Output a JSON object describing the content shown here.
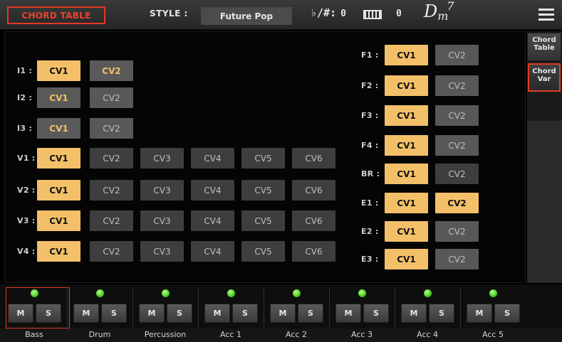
{
  "header": {
    "page_title": "CHORD TABLE",
    "style_label": "STYLE :",
    "style_value": "Future Pop",
    "transpose_symbol": "♭/#:",
    "transpose_value": "0",
    "octave_value": "0",
    "chord_root": "D",
    "chord_sub": "m",
    "chord_sup": "7"
  },
  "side_tabs": {
    "chord_table": "Chord Table",
    "chord_var": "Chord Var"
  },
  "rows_left": [
    {
      "label": "I1 :",
      "cells": [
        {
          "text": "CV1",
          "state": "active"
        },
        {
          "text": "CV2",
          "state": "gold-dim"
        }
      ]
    },
    {
      "label": "I2 :",
      "cells": [
        {
          "text": "CV1",
          "state": "gold-dim"
        },
        {
          "text": "CV2",
          "state": "inactive"
        }
      ]
    },
    {
      "label": "I3 :",
      "cells": [
        {
          "text": "CV1",
          "state": "gold-dim"
        },
        {
          "text": "CV2",
          "state": "inactive"
        }
      ]
    },
    {
      "label": "V1 :",
      "cells": [
        {
          "text": "CV1",
          "state": "active"
        },
        {
          "text": "CV2",
          "state": "dark"
        },
        {
          "text": "CV3",
          "state": "dark"
        },
        {
          "text": "CV4",
          "state": "dark"
        },
        {
          "text": "CV5",
          "state": "dark"
        },
        {
          "text": "CV6",
          "state": "dark"
        }
      ]
    },
    {
      "label": "V2 :",
      "cells": [
        {
          "text": "CV1",
          "state": "active"
        },
        {
          "text": "CV2",
          "state": "dark"
        },
        {
          "text": "CV3",
          "state": "dark"
        },
        {
          "text": "CV4",
          "state": "dark"
        },
        {
          "text": "CV5",
          "state": "dark"
        },
        {
          "text": "CV6",
          "state": "dark"
        }
      ]
    },
    {
      "label": "V3 :",
      "cells": [
        {
          "text": "CV1",
          "state": "active"
        },
        {
          "text": "CV2",
          "state": "dark"
        },
        {
          "text": "CV3",
          "state": "dark"
        },
        {
          "text": "CV4",
          "state": "dark"
        },
        {
          "text": "CV5",
          "state": "dark"
        },
        {
          "text": "CV6",
          "state": "dark"
        }
      ]
    },
    {
      "label": "V4 :",
      "cells": [
        {
          "text": "CV1",
          "state": "active"
        },
        {
          "text": "CV2",
          "state": "dark"
        },
        {
          "text": "CV3",
          "state": "dark"
        },
        {
          "text": "CV4",
          "state": "dark"
        },
        {
          "text": "CV5",
          "state": "dark"
        },
        {
          "text": "CV6",
          "state": "dark"
        }
      ]
    }
  ],
  "rows_right": [
    {
      "label": "F1 :",
      "cells": [
        {
          "text": "CV1",
          "state": "active"
        },
        {
          "text": "CV2",
          "state": "inactive"
        }
      ]
    },
    {
      "label": "F2 :",
      "cells": [
        {
          "text": "CV1",
          "state": "active"
        },
        {
          "text": "CV2",
          "state": "inactive"
        }
      ]
    },
    {
      "label": "F3 :",
      "cells": [
        {
          "text": "CV1",
          "state": "active"
        },
        {
          "text": "CV2",
          "state": "inactive"
        }
      ]
    },
    {
      "label": "F4 :",
      "cells": [
        {
          "text": "CV1",
          "state": "active"
        },
        {
          "text": "CV2",
          "state": "inactive"
        }
      ]
    },
    {
      "label": "BR :",
      "cells": [
        {
          "text": "CV1",
          "state": "active"
        },
        {
          "text": "CV2",
          "state": "dark"
        }
      ]
    },
    {
      "label": "E1 :",
      "cells": [
        {
          "text": "CV1",
          "state": "active"
        },
        {
          "text": "CV2",
          "state": "active"
        }
      ]
    },
    {
      "label": "E2 :",
      "cells": [
        {
          "text": "CV1",
          "state": "active"
        },
        {
          "text": "CV2",
          "state": "inactive"
        }
      ]
    },
    {
      "label": "E3 :",
      "cells": [
        {
          "text": "CV1",
          "state": "active"
        },
        {
          "text": "CV2",
          "state": "inactive"
        }
      ]
    }
  ],
  "tracks": [
    {
      "name": "Bass",
      "mute_label": "M",
      "solo_label": "S"
    },
    {
      "name": "Drum",
      "mute_label": "M",
      "solo_label": "S"
    },
    {
      "name": "Percussion",
      "mute_label": "M",
      "solo_label": "S"
    },
    {
      "name": "Acc 1",
      "mute_label": "M",
      "solo_label": "S"
    },
    {
      "name": "Acc 2",
      "mute_label": "M",
      "solo_label": "S"
    },
    {
      "name": "Acc 3",
      "mute_label": "M",
      "solo_label": "S"
    },
    {
      "name": "Acc 4",
      "mute_label": "M",
      "solo_label": "S"
    },
    {
      "name": "Acc 5",
      "mute_label": "M",
      "solo_label": "S"
    }
  ],
  "colors": {
    "accent_red": "#e23a24",
    "active_gold": "#f3c069",
    "led_green": "#4ccc22"
  }
}
